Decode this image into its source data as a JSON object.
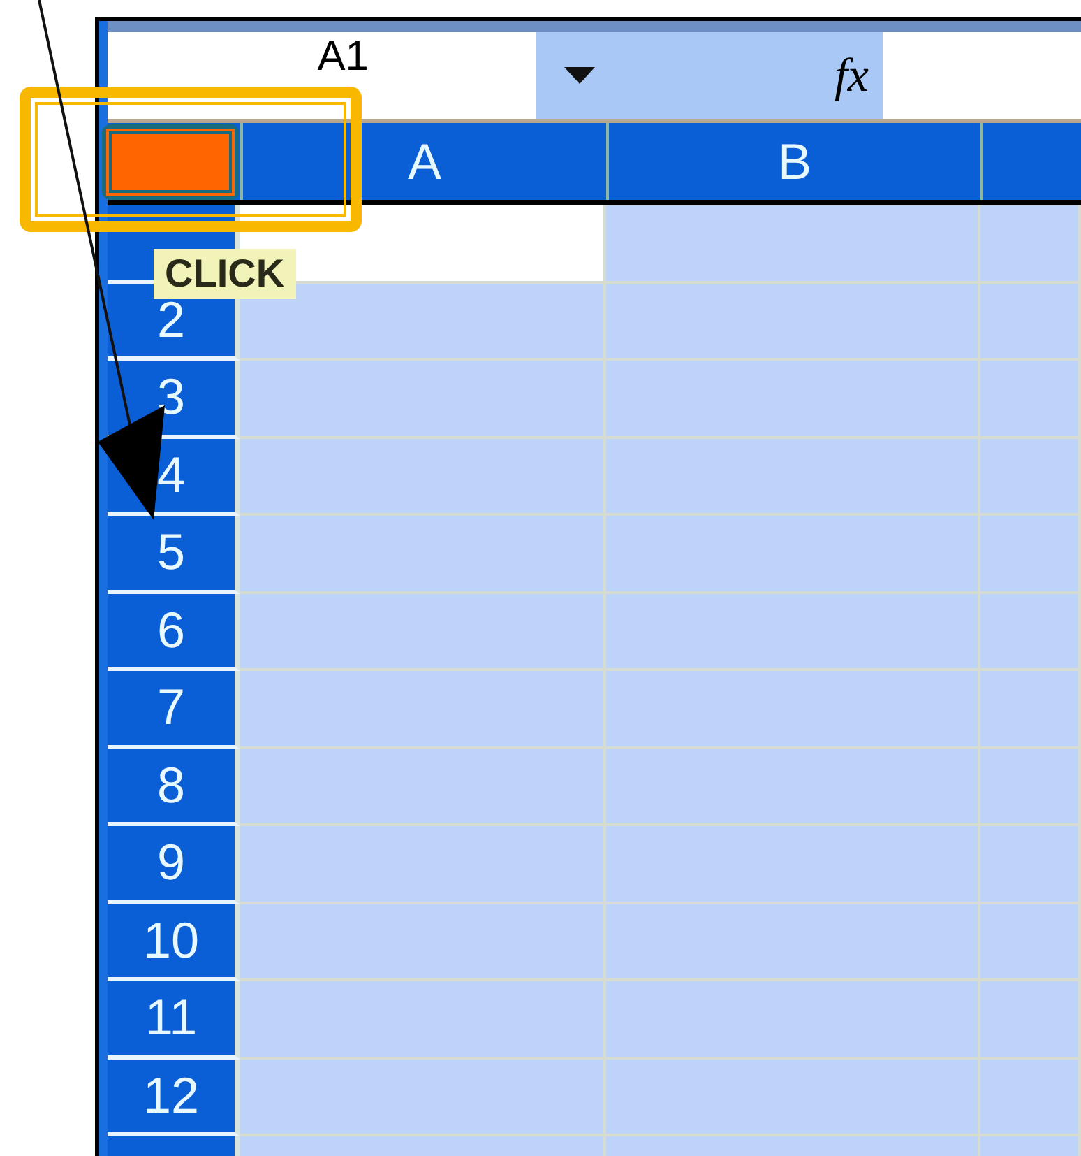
{
  "formula_bar": {
    "name_box": "A1",
    "function_label": "fx"
  },
  "select_all": {
    "highlighted": true
  },
  "columns": [
    "A",
    "B",
    ""
  ],
  "rows": [
    "2",
    "3",
    "4",
    "5",
    "6",
    "7",
    "8",
    "9",
    "10",
    "11",
    "12"
  ],
  "sheet": {
    "all_selected": true
  },
  "callout": {
    "label": "CLICK"
  }
}
